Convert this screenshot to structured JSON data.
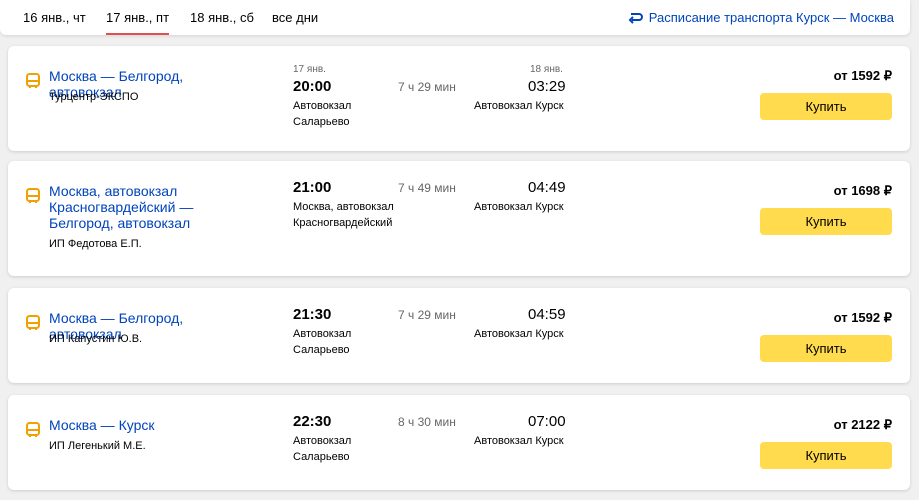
{
  "tabs": [
    {
      "label": "16 янв., чт"
    },
    {
      "label": "17 янв., пт",
      "active": true
    },
    {
      "label": "18 янв., сб"
    },
    {
      "label": "все дни"
    }
  ],
  "schedule_link": "Расписание транспорта Курск — Москва",
  "buy_label": "Купить",
  "accent_color": "#ffdb4d",
  "link_color": "#0044bb",
  "trips": [
    {
      "route": "Москва — Белгород, автовокзал",
      "carrier": "Турцентр-ЭКСПО",
      "dep_date": "17 янв.",
      "dep_time": "20:00",
      "dep_station": "Автовокзал Саларьево",
      "duration": "7 ч 29 мин",
      "arr_date": "18 янв.",
      "arr_time": "03:29",
      "arr_station": "Автовокзал Курск",
      "price": "от 1592 ₽"
    },
    {
      "route": "Москва, автовокзал Красногвардейский — Белгород, автовокзал",
      "carrier": "ИП Федотова Е.П.",
      "dep_time": "21:00",
      "dep_station": "Москва, автовокзал Красногвардейский",
      "duration": "7 ч 49 мин",
      "arr_time": "04:49",
      "arr_station": "Автовокзал Курск",
      "price": "от 1698 ₽"
    },
    {
      "route": "Москва — Белгород, автовокзал",
      "carrier": "ИП Капустин Ю.В.",
      "dep_time": "21:30",
      "dep_station": "Автовокзал Саларьево",
      "duration": "7 ч 29 мин",
      "arr_time": "04:59",
      "arr_station": "Автовокзал Курск",
      "price": "от 1592 ₽"
    },
    {
      "route": "Москва — Курск",
      "carrier": "ИП Легенький М.Е.",
      "dep_time": "22:30",
      "dep_station": "Автовокзал Саларьево",
      "duration": "8 ч 30 мин",
      "arr_time": "07:00",
      "arr_station": "Автовокзал Курск",
      "price": "от 2122 ₽"
    }
  ]
}
